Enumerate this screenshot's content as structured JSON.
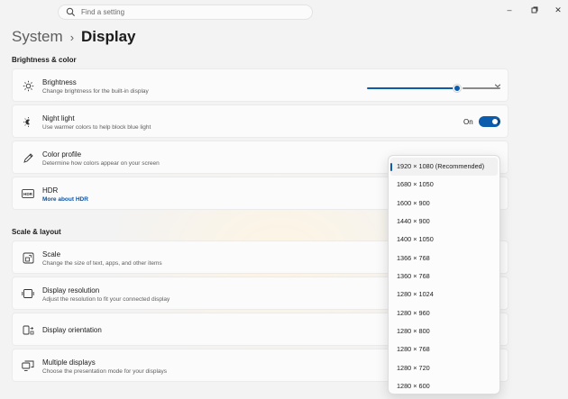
{
  "search": {
    "placeholder": "Find a setting"
  },
  "window_controls": {
    "minimize": "–",
    "maximize": "▢",
    "close": "✕"
  },
  "breadcrumb": {
    "parent": "System",
    "separator": "›",
    "current": "Display"
  },
  "sections": {
    "brightness_color": "Brightness & color",
    "scale_layout": "Scale & layout"
  },
  "cards": {
    "brightness": {
      "title": "Brightness",
      "subtitle": "Change brightness for the built-in display",
      "icon": "sun-icon",
      "level": 0.67
    },
    "night_light": {
      "title": "Night light",
      "subtitle": "Use warmer colors to help block blue light",
      "icon": "night-light-icon",
      "state": "On"
    },
    "color_profile": {
      "title": "Color profile",
      "subtitle": "Determine how colors appear on your screen",
      "icon": "pen-icon"
    },
    "hdr": {
      "title": "HDR",
      "link": "More about HDR",
      "icon": "hdr-icon"
    },
    "scale": {
      "title": "Scale",
      "subtitle": "Change the size of text, apps, and other items",
      "icon": "scale-icon"
    },
    "display_resolution": {
      "title": "Display resolution",
      "subtitle": "Adjust the resolution to fit your connected display",
      "icon": "resolution-icon"
    },
    "display_orientation": {
      "title": "Display orientation",
      "icon": "orientation-icon"
    },
    "multiple_displays": {
      "title": "Multiple displays",
      "subtitle": "Choose the presentation mode for your displays",
      "icon": "multiple-displays-icon"
    }
  },
  "resolution_dropdown": {
    "selected_index": 0,
    "options": [
      "1920 × 1080 (Recommended)",
      "1680 × 1050",
      "1600 × 900",
      "1440 × 900",
      "1400 × 1050",
      "1366 × 768",
      "1360 × 768",
      "1280 × 1024",
      "1280 × 960",
      "1280 × 800",
      "1280 × 768",
      "1280 × 720",
      "1280 × 600"
    ]
  },
  "colors": {
    "accent": "#0b5cad",
    "link": "#0a56a8",
    "background": "#f3f3f3",
    "card": "#fbfbfb"
  }
}
